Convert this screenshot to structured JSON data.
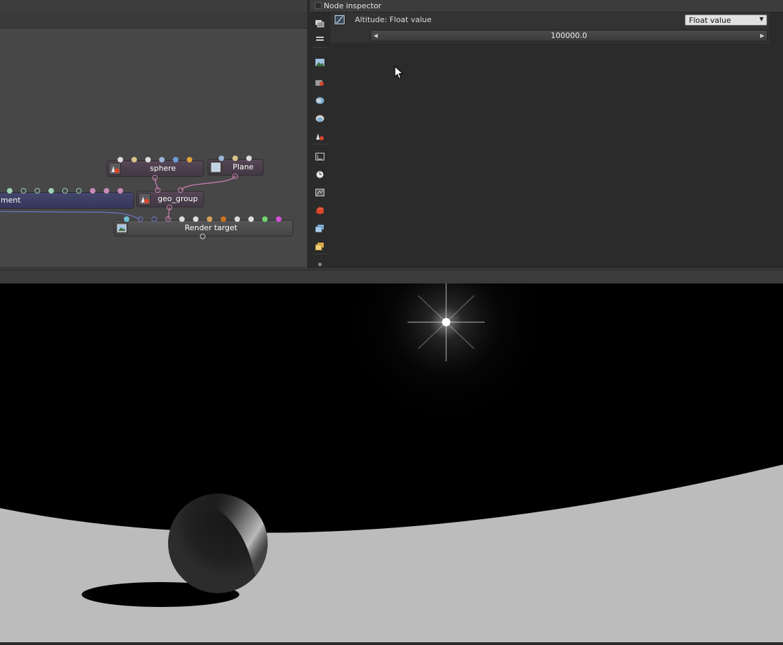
{
  "inspector": {
    "title": "Node inspector",
    "param_label": "Altitude: Float value",
    "type_select": "Float value",
    "slider_value": "100000.0",
    "param_icon": "curve-icon"
  },
  "graph": {
    "nodes": {
      "environment_label": "ment",
      "sphere_label": "sphere",
      "plane_label": "Plane",
      "geo_group_label": "geo_group",
      "render_target_label": "Render target"
    }
  },
  "toolbar": {
    "buttons": [
      "copy-icon",
      "layers-icon",
      "image-icon",
      "camera-icon",
      "mesh-icon",
      "mesh-stack-icon",
      "material-icon",
      "transform-icon",
      "clock-icon",
      "texture-icon",
      "red-cube-icon",
      "cube-stack-icon",
      "orange-cube-stack-icon",
      "dot-icon"
    ]
  },
  "viewport": {
    "scene": "rendered-sphere-on-planet-horizon-with-sun"
  },
  "colors": {
    "accent_pink": "#c97fb0",
    "accent_blue": "#6c75c4",
    "environment_node": "#3c3d62",
    "geometry_node": "#4a3c48"
  }
}
